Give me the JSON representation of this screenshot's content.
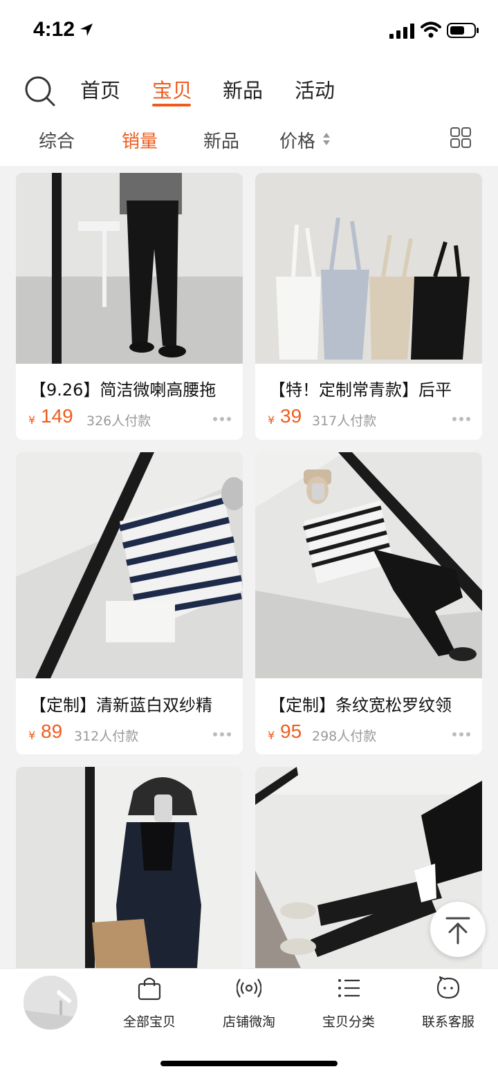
{
  "status": {
    "time": "4:12"
  },
  "header": {
    "tabs": [
      {
        "label": "首页",
        "active": false
      },
      {
        "label": "宝贝",
        "active": true
      },
      {
        "label": "新品",
        "active": false
      },
      {
        "label": "活动",
        "active": false
      }
    ],
    "sort_tabs": [
      {
        "label": "综合",
        "active": false
      },
      {
        "label": "销量",
        "active": true
      },
      {
        "label": "新品",
        "active": false
      },
      {
        "label": "价格",
        "active": false
      }
    ]
  },
  "products": [
    {
      "title": "【9.26】简洁微喇高腰拖",
      "currency": "¥",
      "price": "149",
      "sales": "326人付款",
      "image": "black-wide-pants-photo"
    },
    {
      "title": "【特！定制常青款】后平",
      "currency": "¥",
      "price": "39",
      "sales": "317人付款",
      "image": "camisole-tops-photo"
    },
    {
      "title": "【定制】清新蓝白双纱精",
      "currency": "¥",
      "price": "89",
      "sales": "312人付款",
      "image": "striped-shirt-photo"
    },
    {
      "title": "【定制】条纹宽松罗纹领",
      "currency": "¥",
      "price": "95",
      "sales": "298人付款",
      "image": "striped-tee-photo"
    },
    {
      "title": "",
      "currency": "",
      "price": "",
      "sales": "",
      "image": "denim-jacket-photo"
    },
    {
      "title": "",
      "currency": "",
      "price": "",
      "sales": "",
      "image": "black-leggings-photo"
    }
  ],
  "bottom_nav": [
    {
      "label": "全部宝贝",
      "icon": "shopping-bag-icon"
    },
    {
      "label": "店铺微淘",
      "icon": "broadcast-icon"
    },
    {
      "label": "宝贝分类",
      "icon": "list-icon"
    },
    {
      "label": "联系客服",
      "icon": "chat-bubble-icon"
    }
  ],
  "colors": {
    "accent": "#ef5b1c",
    "background": "#f2f2f2",
    "text_muted": "#999999"
  }
}
